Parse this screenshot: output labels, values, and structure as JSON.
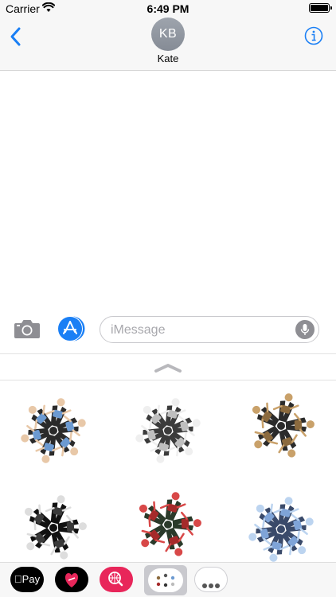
{
  "status_bar": {
    "carrier": "Carrier",
    "time": "6:49 PM"
  },
  "header": {
    "back_icon": "chevron-left-icon",
    "avatar_initials": "KB",
    "contact_name": "Kate",
    "info_icon": "info-icon"
  },
  "compose": {
    "camera_icon": "camera-icon",
    "appstore_icon": "app-store-icon",
    "placeholder": "iMessage",
    "mic_icon": "microphone-icon"
  },
  "drawer": {
    "handle_icon": "chevron-up-icon"
  },
  "stickers": [
    {
      "name": "sticker-kaleidoscope-1",
      "colors": [
        "#2a2a2a",
        "#6c9ad1",
        "#e8c8a8"
      ]
    },
    {
      "name": "sticker-kaleidoscope-2",
      "colors": [
        "#3b3b3b",
        "#bfbfbf",
        "#efefef"
      ]
    },
    {
      "name": "sticker-kaleidoscope-3",
      "colors": [
        "#2b2b2b",
        "#8b6a3e",
        "#c9a16a"
      ]
    },
    {
      "name": "sticker-kaleidoscope-4",
      "colors": [
        "#111111",
        "#3a3a3a",
        "#dddddd"
      ]
    },
    {
      "name": "sticker-kaleidoscope-5",
      "colors": [
        "#2a3a2a",
        "#a52a2a",
        "#d84848"
      ]
    },
    {
      "name": "sticker-kaleidoscope-6",
      "colors": [
        "#3a4a6a",
        "#7fa4d8",
        "#bcd4f0"
      ]
    }
  ],
  "app_strip": {
    "applepay_label": "Pay",
    "apple_icon": "apple-icon",
    "heart_icon": "heart-icon",
    "search_app_icon": "globe-search-icon",
    "sticker_app_icon": "sticker-pack-icon",
    "more_icon": "more-icon"
  },
  "colors": {
    "accent": "#1a7ff5",
    "bar_background": "#f7f7f7",
    "pink": "#e8265a"
  }
}
